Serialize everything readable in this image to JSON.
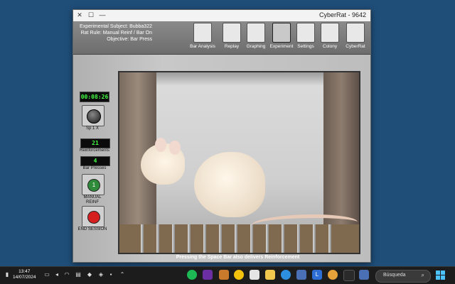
{
  "window": {
    "title": "CyberRat - 9642",
    "controls": {
      "close": "✕",
      "maximize": "☐",
      "minimize": "—"
    }
  },
  "subject_info": {
    "line1": "Experimental Subject: Bubba322",
    "line2": "Rat Rule: Manual Reinf / Bar On",
    "line3": "Objective: Bar Press"
  },
  "toolbar": {
    "items": [
      {
        "label": "Bar Analysis",
        "icon": "bar-analysis-icon"
      },
      {
        "label": "Replay",
        "icon": "replay-icon"
      },
      {
        "label": "Graphing",
        "icon": "graphing-icon"
      },
      {
        "label": "Experiment",
        "icon": "experiment-icon"
      },
      {
        "label": "Settings",
        "icon": "settings-icon"
      },
      {
        "label": "Colony",
        "icon": "colony-icon"
      },
      {
        "label": "CyberRat",
        "icon": "cyberrat-icon"
      }
    ]
  },
  "panel": {
    "timer": "00:08:26",
    "speed_label": "Sp 1 X",
    "reinforcements_value": "21",
    "reinforcements_label": "Reinforcements",
    "bar_presses_value": "4",
    "bar_presses_label": "Bar Presses",
    "manual_button_glyph": "1",
    "manual_label_line1": "MANUAL",
    "manual_label_line2": "REINF",
    "end_label": "END SESSION"
  },
  "video": {
    "subtitle": "Pressing the Space Bar also delivers Reinforcement"
  },
  "taskbar": {
    "time": "13:47",
    "date": "14/07/2024",
    "search_placeholder": "Búsqueda",
    "app_badge": "L"
  },
  "colors": {
    "desktop": "#1f4e79",
    "led_green": "#44ff44",
    "manual_button": "#2f8a3a",
    "end_button": "#d62020"
  }
}
